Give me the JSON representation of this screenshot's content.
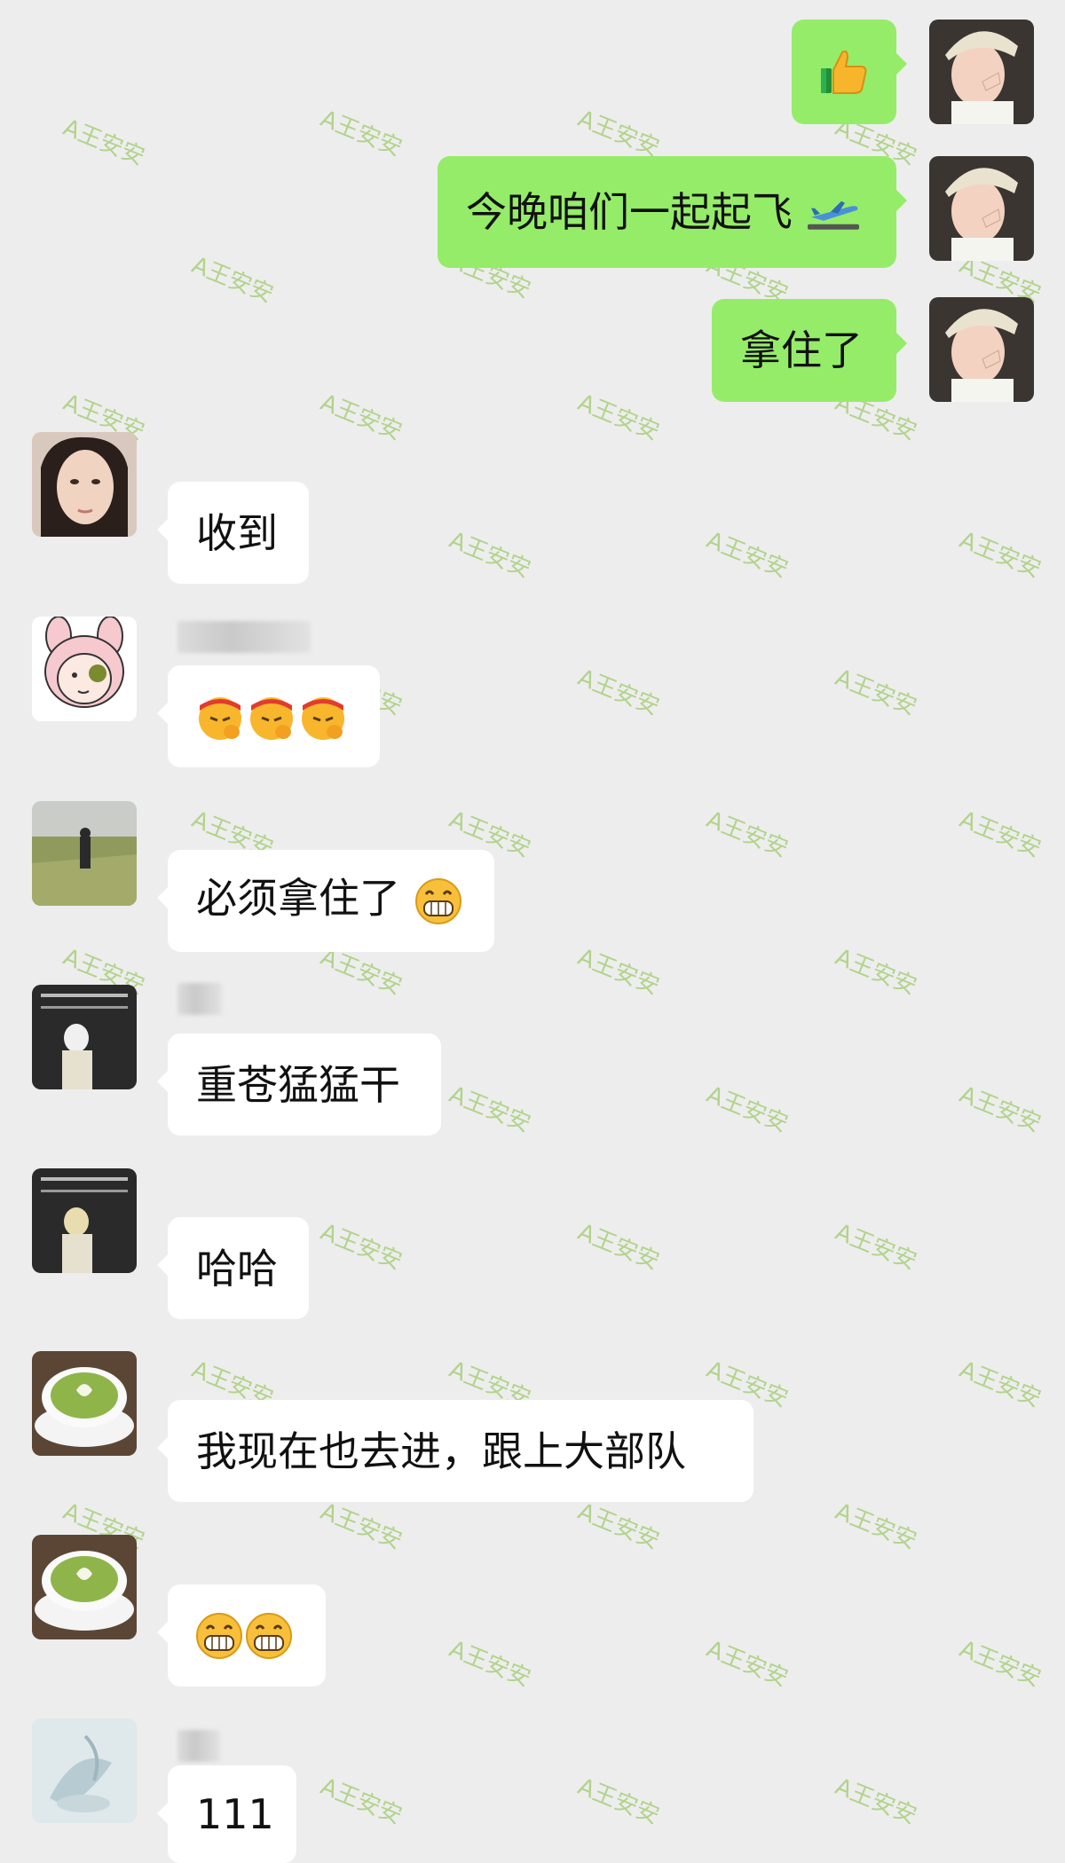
{
  "watermark_text": "A王安安",
  "colors": {
    "background": "#ededed",
    "outgoing_bubble": "#95ec69",
    "incoming_bubble": "#ffffff"
  },
  "messages": [
    {
      "dir": "out",
      "text": "",
      "icons": [
        "thumbs-up-emoji"
      ]
    },
    {
      "dir": "out",
      "text": "今晚咱们一起起飞",
      "icons": [
        "airplane-emoji"
      ]
    },
    {
      "dir": "out",
      "text": "拿住了"
    },
    {
      "dir": "in",
      "text": "收到"
    },
    {
      "dir": "in",
      "text": "",
      "icons": [
        "salute-emoji",
        "salute-emoji",
        "salute-emoji"
      ]
    },
    {
      "dir": "in",
      "text": "必须拿住了",
      "icons": [
        "grin-emoji"
      ]
    },
    {
      "dir": "in",
      "text": "重苍猛猛干"
    },
    {
      "dir": "in",
      "text": "哈哈"
    },
    {
      "dir": "in",
      "text": "我现在也去进，跟上大部队"
    },
    {
      "dir": "in",
      "text": "",
      "icons": [
        "grin-emoji",
        "grin-emoji"
      ]
    },
    {
      "dir": "in",
      "text": "111"
    }
  ]
}
